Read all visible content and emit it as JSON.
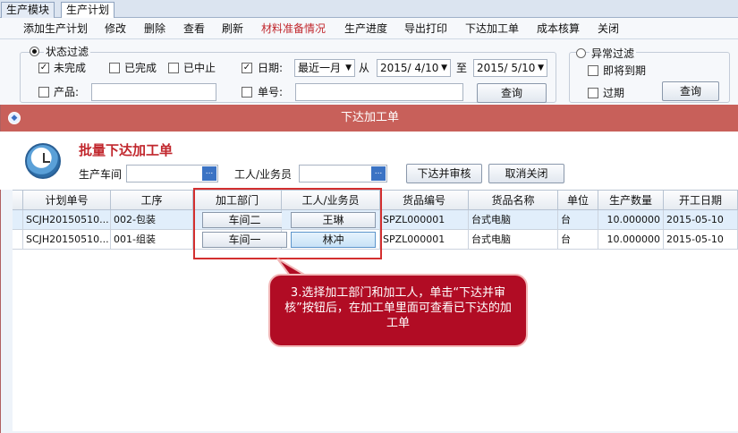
{
  "module_tabs": [
    "生产模块",
    "生产计划"
  ],
  "toolbar": [
    "添加生产计划",
    "修改",
    "删除",
    "查看",
    "刷新",
    "材料准备情况",
    "生产进度",
    "导出打印",
    "下达加工单",
    "成本核算",
    "关闭"
  ],
  "status_filter": {
    "label": "状态过滤",
    "unfinished": "未完成",
    "finished": "已完成",
    "stopped": "已中止",
    "date_label": "日期:",
    "date_range": "最近一月",
    "from_label": "从",
    "from_date": "2015/ 4/10",
    "to_label": "至",
    "to_date": "2015/ 5/10",
    "product_label": "产品:",
    "order_label": "单号:",
    "query": "查询"
  },
  "abnormal_filter": {
    "label": "异常过滤",
    "due_soon": "即将到期",
    "overdue": "过期",
    "query": "查询"
  },
  "dialog": {
    "window_title": "下达加工单",
    "heading": "批量下达加工单",
    "workshop_label": "生产车间",
    "worker_label": "工人/业务员",
    "lookup": "...",
    "approve_button": "下达并审核",
    "cancel_button": "取消关闭"
  },
  "grid": {
    "columns": [
      "计划单号",
      "工序",
      "加工部门",
      "工人/业务员",
      "货品编号",
      "货品名称",
      "单位",
      "生产数量",
      "开工日期"
    ],
    "rows": [
      [
        "SCJH20150510...",
        "002-包装",
        "车间二",
        "王琳",
        "SPZL000001",
        "台式电脑",
        "台",
        "10.000000",
        "2015-05-10"
      ],
      [
        "SCJH20150510...",
        "001-组装",
        "车间一",
        "林冲",
        "SPZL000001",
        "台式电脑",
        "台",
        "10.000000",
        "2015-05-10"
      ]
    ]
  },
  "callout": "3.选择加工部门和加工人，单击“下达并审核”按钮后，在加工单里面可查看已下达的加工单",
  "colors": {
    "title_bar": "#c8605a",
    "callout": "#b10c24",
    "highlight": "#d32f2f",
    "accent_red": "#c1272d"
  }
}
